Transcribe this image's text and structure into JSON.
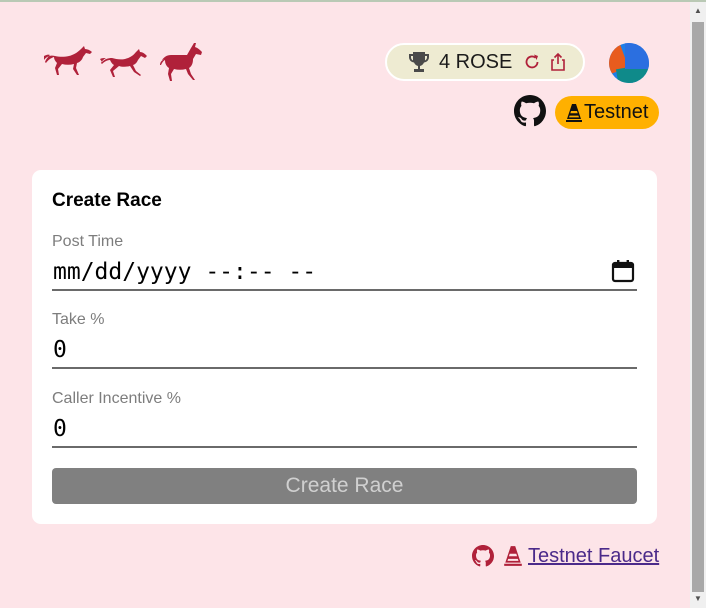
{
  "header": {
    "logo_icons": [
      "horse-icon",
      "horse-icon",
      "horse-icon"
    ],
    "balance": {
      "amount": "4",
      "currency": "ROSE",
      "display": "4 ROSE",
      "trophy_icon": "trophy-icon",
      "refresh_icon": "refresh-icon",
      "share_icon": "share-icon"
    },
    "network_label": "Testnet",
    "github_icon": "github-icon",
    "network_icon": "traffic-cone-icon"
  },
  "form": {
    "title": "Create Race",
    "post_time": {
      "label": "Post Time",
      "value": "mm/dd/yyyy --:-- --",
      "icon": "calendar-icon"
    },
    "take": {
      "label": "Take %",
      "value": "0"
    },
    "caller_incentive": {
      "label": "Caller Incentive %",
      "value": "0"
    },
    "submit_label": "Create Race"
  },
  "footer": {
    "faucet_link": "Testnet Faucet",
    "icons": [
      "github-icon",
      "traffic-cone-icon"
    ]
  },
  "colors": {
    "background": "#fde4e8",
    "brand": "#b0213a",
    "testnet_badge": "#ffb000",
    "balance_pill": "#eeebd2",
    "disabled_button": "#808080",
    "link": "#4b2a8a"
  }
}
